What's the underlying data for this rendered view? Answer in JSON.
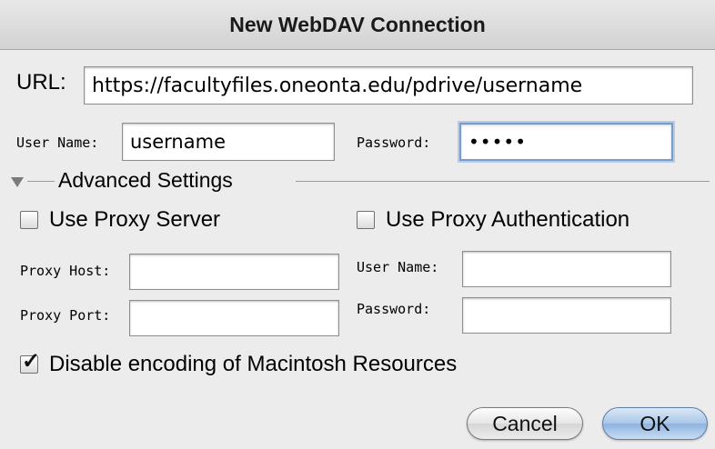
{
  "window": {
    "title": "New WebDAV Connection"
  },
  "connection": {
    "url_label": "URL:",
    "url_value": "https://facultyfiles.oneonta.edu/pdrive/username",
    "username_label": "User Name:",
    "username_value": "username",
    "password_label": "Password:",
    "password_value": "•••••"
  },
  "advanced": {
    "section_label": "Advanced Settings",
    "use_proxy_server": {
      "label": "Use Proxy Server",
      "checked": false
    },
    "use_proxy_auth": {
      "label": "Use Proxy Authentication",
      "checked": false
    },
    "proxy_host_label": "Proxy Host:",
    "proxy_host_value": "",
    "proxy_port_label": "Proxy Port:",
    "proxy_port_value": "",
    "proxy_username_label": "User Name:",
    "proxy_username_value": "",
    "proxy_password_label": "Password:",
    "proxy_password_value": "",
    "disable_encoding": {
      "label": "Disable encoding of Macintosh Resources",
      "checked": true
    }
  },
  "buttons": {
    "cancel": "Cancel",
    "ok": "OK"
  },
  "colors": {
    "default_button": "#a9c6e8",
    "focus_ring": "#7a9cc8"
  }
}
